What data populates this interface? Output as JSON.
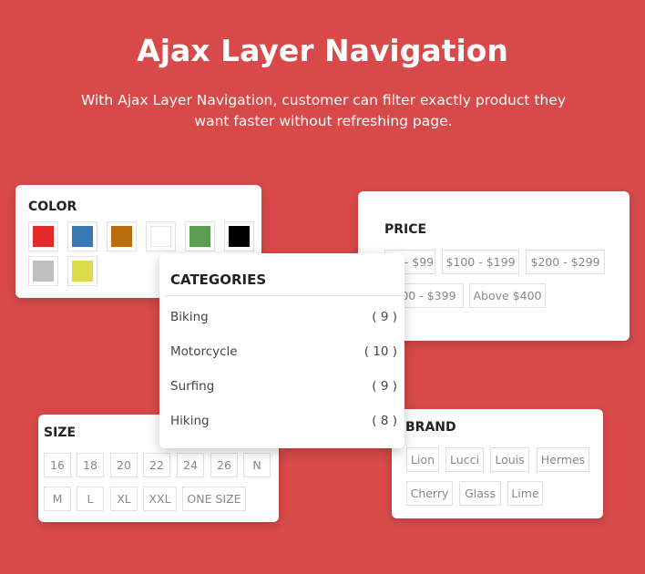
{
  "header": {
    "title": "Ajax Layer Navigation",
    "subtitle": "With Ajax Layer Navigation, customer can filter exactly product they want faster without refreshing page."
  },
  "color": {
    "title": "COLOR",
    "swatches": [
      "#e12a2b",
      "#3878b5",
      "#bc6d0b",
      "#ffffff",
      "#5a9e50",
      "#000000",
      "#c0c0c0",
      "#dcdc4a"
    ]
  },
  "price": {
    "title": "PRICE",
    "options": [
      "$0 - $99",
      "$100 - $199",
      "$200 - $299",
      "$300 - $399",
      "Above $400"
    ]
  },
  "categories": {
    "title": "CATEGORIES",
    "items": [
      {
        "label": "Biking",
        "count": "( 9 )"
      },
      {
        "label": "Motorcycle",
        "count": "( 10 )"
      },
      {
        "label": "Surfing",
        "count": "( 9 )"
      },
      {
        "label": "Hiking",
        "count": "( 8 )"
      }
    ]
  },
  "size": {
    "title": "SIZE",
    "options": [
      "16",
      "18",
      "20",
      "22",
      "24",
      "26",
      "N",
      "M",
      "L",
      "XL",
      "XXL",
      "ONE SIZE"
    ]
  },
  "brand": {
    "title": "BRAND",
    "options": [
      "Lion",
      "Lucci",
      "Louis",
      "Hermes",
      "Cherry",
      "Glass",
      "Lime"
    ]
  }
}
